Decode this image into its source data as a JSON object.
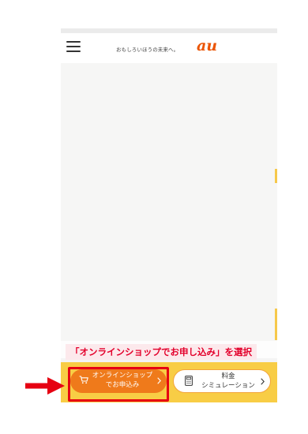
{
  "header": {
    "tagline": "おもしろいほうの未来へ。",
    "logo_text": "au"
  },
  "annotation": {
    "text": "「オンラインショップでお申し込み」を選択"
  },
  "bottom_bar": {
    "shop_button": {
      "line1": "オンラインショップ",
      "line2": "でお申込み"
    },
    "sim_button": {
      "line1": "料金",
      "line2": "シミュレーション"
    }
  },
  "colors": {
    "accent_orange": "#ef7a1b",
    "bar_yellow": "#f8cd45",
    "highlight_red": "#e60012",
    "logo_orange": "#eb5505"
  },
  "icons": [
    "menu-icon",
    "cart-icon",
    "chevron-right-icon",
    "calculator-icon",
    "arrow-right-icon"
  ]
}
